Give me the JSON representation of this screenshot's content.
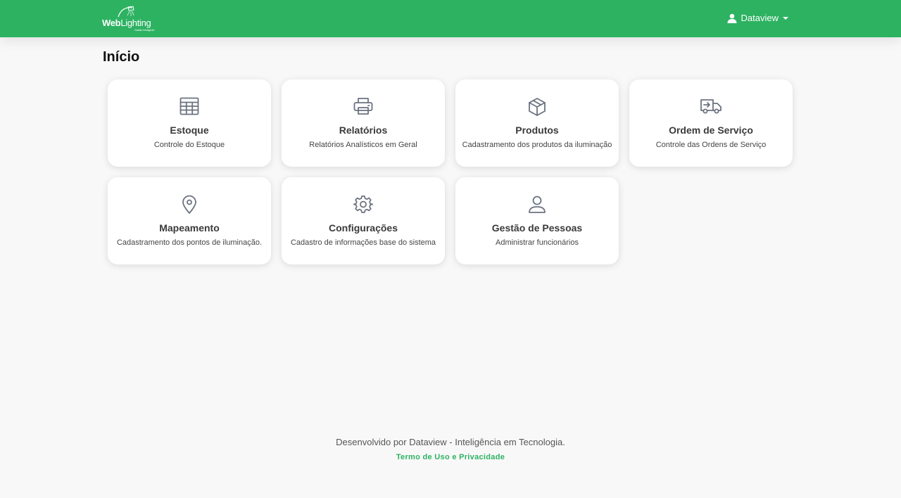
{
  "header": {
    "logo_text_bold": "Web",
    "logo_text_light": "Lighting",
    "logo_tagline": "Gestão Inteligente",
    "user_name": "Dataview",
    "accent_color": "#2db262"
  },
  "page": {
    "title": "Início"
  },
  "cards": [
    {
      "title": "Estoque",
      "description": "Controle do Estoque",
      "icon": "table-icon"
    },
    {
      "title": "Relatórios",
      "description": "Relatórios Analísticos em Geral",
      "icon": "printer-icon"
    },
    {
      "title": "Produtos",
      "description": "Cadastramento dos produtos da iluminação",
      "icon": "cube-icon"
    },
    {
      "title": "Ordem de Serviço",
      "description": "Controle das Ordens de Serviço",
      "icon": "truck-icon"
    },
    {
      "title": "Mapeamento",
      "description": "Cadastramento dos pontos de iluminação.",
      "icon": "map-pin-icon"
    },
    {
      "title": "Configurações",
      "description": "Cadastro de informações base do sistema",
      "icon": "gear-icon"
    },
    {
      "title": "Gestão de Pessoas",
      "description": "Administrar funcionários",
      "icon": "user-icon"
    }
  ],
  "footer": {
    "text": "Desenvolvido por Dataview - Inteligência em Tecnologia.",
    "link": "Termo de Uso e Privacidade"
  }
}
